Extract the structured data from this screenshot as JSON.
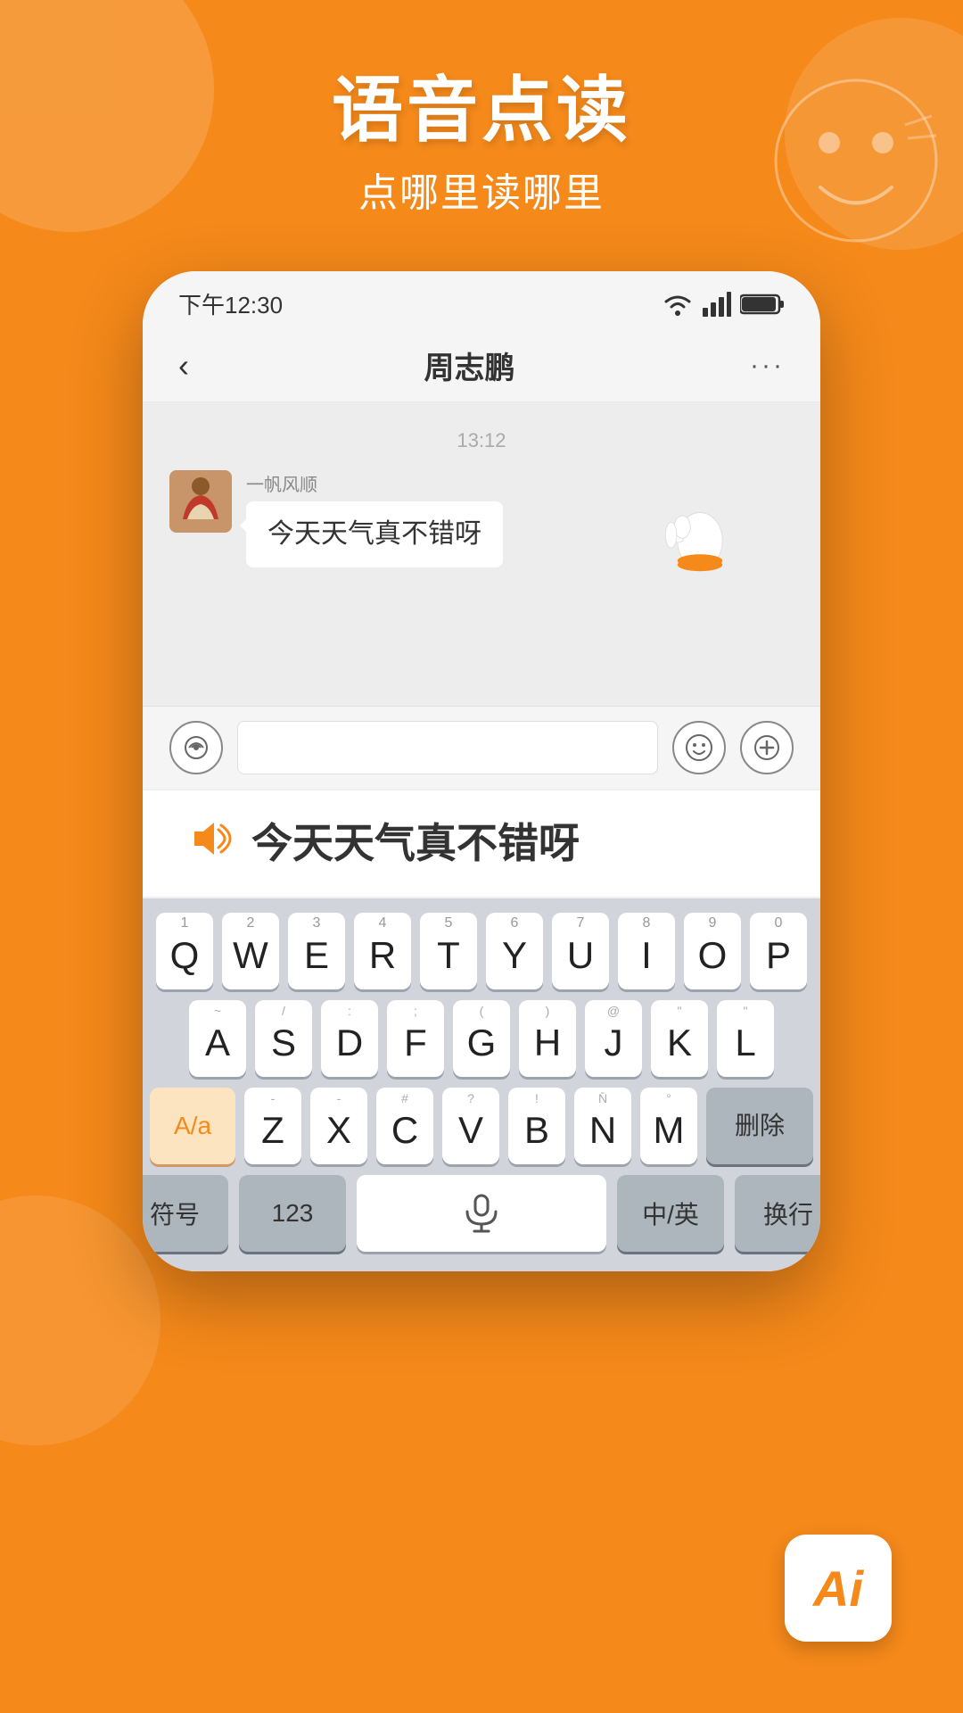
{
  "background_color": "#F5891A",
  "header": {
    "main_title": "语音点读",
    "sub_title": "点哪里读哪里"
  },
  "status_bar": {
    "time": "下午12:30",
    "wifi": "wifi",
    "signal": "signal",
    "battery": "battery"
  },
  "chat": {
    "title": "周志鹏",
    "back_label": "‹",
    "more_label": "···",
    "timestamp": "13:12",
    "sender_name": "一帆风顺",
    "message": "今天天气真不错呀"
  },
  "tts": {
    "text": "今天天气真不错呀",
    "icon": "🔊"
  },
  "keyboard": {
    "rows": [
      {
        "keys": [
          {
            "letter": "Q",
            "num": "1"
          },
          {
            "letter": "W",
            "num": "2"
          },
          {
            "letter": "E",
            "num": "3"
          },
          {
            "letter": "R",
            "num": "4"
          },
          {
            "letter": "T",
            "num": "5"
          },
          {
            "letter": "Y",
            "num": "6"
          },
          {
            "letter": "U",
            "num": "7"
          },
          {
            "letter": "I",
            "num": "8"
          },
          {
            "letter": "O",
            "num": "9"
          },
          {
            "letter": "P",
            "num": "0"
          }
        ]
      },
      {
        "keys": [
          {
            "letter": "A",
            "sub": "~"
          },
          {
            "letter": "S",
            "sub": "/"
          },
          {
            "letter": "D",
            "sub": ":"
          },
          {
            "letter": "F",
            "sub": ";"
          },
          {
            "letter": "G",
            "sub": "("
          },
          {
            "letter": "H",
            "sub": ")"
          },
          {
            "letter": "J",
            "sub": "@"
          },
          {
            "letter": "K",
            "sub": "\""
          },
          {
            "letter": "L",
            "sub": "\""
          }
        ]
      },
      {
        "keys": [
          {
            "letter": "A/a",
            "special": "caps"
          },
          {
            "letter": "Z",
            "sub": "-"
          },
          {
            "letter": "X",
            "sub": "-"
          },
          {
            "letter": "C",
            "sub": "#"
          },
          {
            "letter": "V",
            "sub": "?"
          },
          {
            "letter": "B",
            "sub": "!"
          },
          {
            "letter": "N",
            "sub": "N"
          },
          {
            "letter": "M",
            "sub": "°"
          },
          {
            "letter": "删除",
            "special": "delete"
          }
        ]
      }
    ],
    "bottom_row": {
      "symbols": "符号",
      "numbers": "123",
      "mic": "mic",
      "lang": "中/英",
      "enter": "换行"
    }
  },
  "ai_badge": "Ai"
}
